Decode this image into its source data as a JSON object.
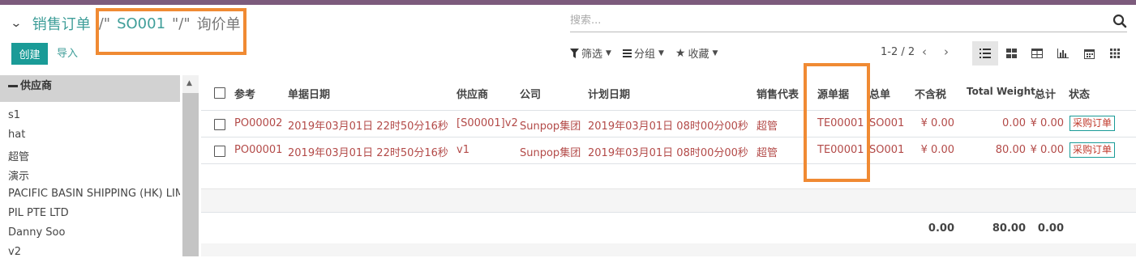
{
  "breadcrumb": {
    "toggle_icon": "chevron-down-icon",
    "root": "销售订单",
    "sep1": "/\"",
    "order": "SO001",
    "sep2": "\"/\"",
    "current": "询价单"
  },
  "actions": {
    "create": "创建",
    "import": "导入"
  },
  "search": {
    "placeholder": "搜索..."
  },
  "filters": {
    "filter": "筛选",
    "group": "分组",
    "favorites": "收藏"
  },
  "pager": {
    "text": "1-2 / 2",
    "prev": "‹",
    "next": "›"
  },
  "views": [
    "list-view-icon",
    "kanban-view-icon",
    "pivot-view-icon",
    "graph-view-icon",
    "calendar-view-icon",
    "grid-view-icon"
  ],
  "sidebar": {
    "header": "供应商",
    "items": [
      "s1",
      "hat",
      "超管",
      "演示",
      "PACIFIC BASIN SHIPPING (HK) LIMITED",
      "PIL PTE LTD",
      "Danny Soo",
      "v2"
    ]
  },
  "table": {
    "columns": [
      "参考",
      "单据日期",
      "供应商",
      "公司",
      "计划日期",
      "销售代表",
      "源单据",
      "总单",
      "不含税",
      "Total Weight",
      "总计",
      "状态"
    ],
    "rows": [
      {
        "ref": "PO00002",
        "date": "2019年03月01日 22时50分16秒",
        "vendor": "[S00001]v2",
        "company": "Sunpop集团",
        "planned": "2019年03月01日 08时00分00秒",
        "rep": "超管",
        "source": "TE00001",
        "origin": "SO001",
        "untaxed": "¥ 0.00",
        "weight": "0.00",
        "total": "¥ 0.00",
        "status": "采购订单"
      },
      {
        "ref": "PO00001",
        "date": "2019年03月01日 22时50分16秒",
        "vendor": "v1",
        "company": "Sunpop集团",
        "planned": "2019年03月01日 08时00分00秒",
        "rep": "超管",
        "source": "TE00001",
        "origin": "SO001",
        "untaxed": "¥ 0.00",
        "weight": "80.00",
        "total": "¥ 0.00",
        "status": "采购订单"
      }
    ],
    "footer": {
      "untaxed": "0.00",
      "weight": "80.00",
      "total": "0.00"
    }
  },
  "colors": {
    "accent": "#1a9b97",
    "highlight": "#f08a33",
    "topbar": "#7c5b7c",
    "link_red": "#b34a48"
  }
}
